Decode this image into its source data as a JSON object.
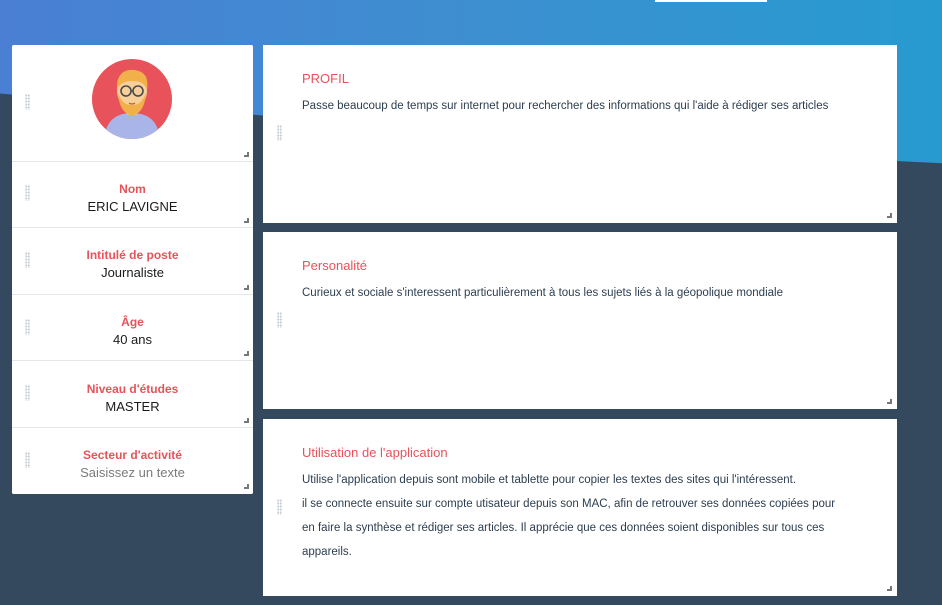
{
  "persona": {
    "fields": [
      {
        "label": "Nom",
        "value": "ERIC LAVIGNE",
        "placeholder": false
      },
      {
        "label": "Intitulé de poste",
        "value": "Journaliste",
        "placeholder": false
      },
      {
        "label": "Âge",
        "value": "40 ans",
        "placeholder": false
      },
      {
        "label": "Niveau d'études",
        "value": "MASTER",
        "placeholder": false
      },
      {
        "label": "Secteur d'activité",
        "value": "Saisissez un texte",
        "placeholder": true
      }
    ]
  },
  "sections": [
    {
      "title": "PROFIL",
      "lines": [
        "Passe beaucoup de temps sur internet pour rechercher des informations qui l'aide à rédiger ses articles"
      ]
    },
    {
      "title": "Personalité",
      "lines": [
        "Curieux et sociale s'interessent particulièrement à tous les sujets liés à la géopolique mondiale"
      ]
    },
    {
      "title": "Utilisation de l'application",
      "lines": [
        "Utilise l'application depuis sont mobile et tablette pour copier les textes des sites qui l'intéressent.",
        "il se connecte ensuite sur compte utisateur depuis son MAC, afin de retrouver ses données copiées pour",
        "en faire la synthèse et rédiger ses articles. Il apprécie que ces données soient disponibles sur tous ces",
        "appareils."
      ]
    }
  ],
  "colors": {
    "accent": "#e8525a",
    "background": "#34495e",
    "header_gradient_start": "#4a7fd4",
    "header_gradient_end": "#279bd0"
  },
  "icons": [
    "avatar-illustration",
    "drag-handle-icon",
    "resize-handle-icon"
  ]
}
